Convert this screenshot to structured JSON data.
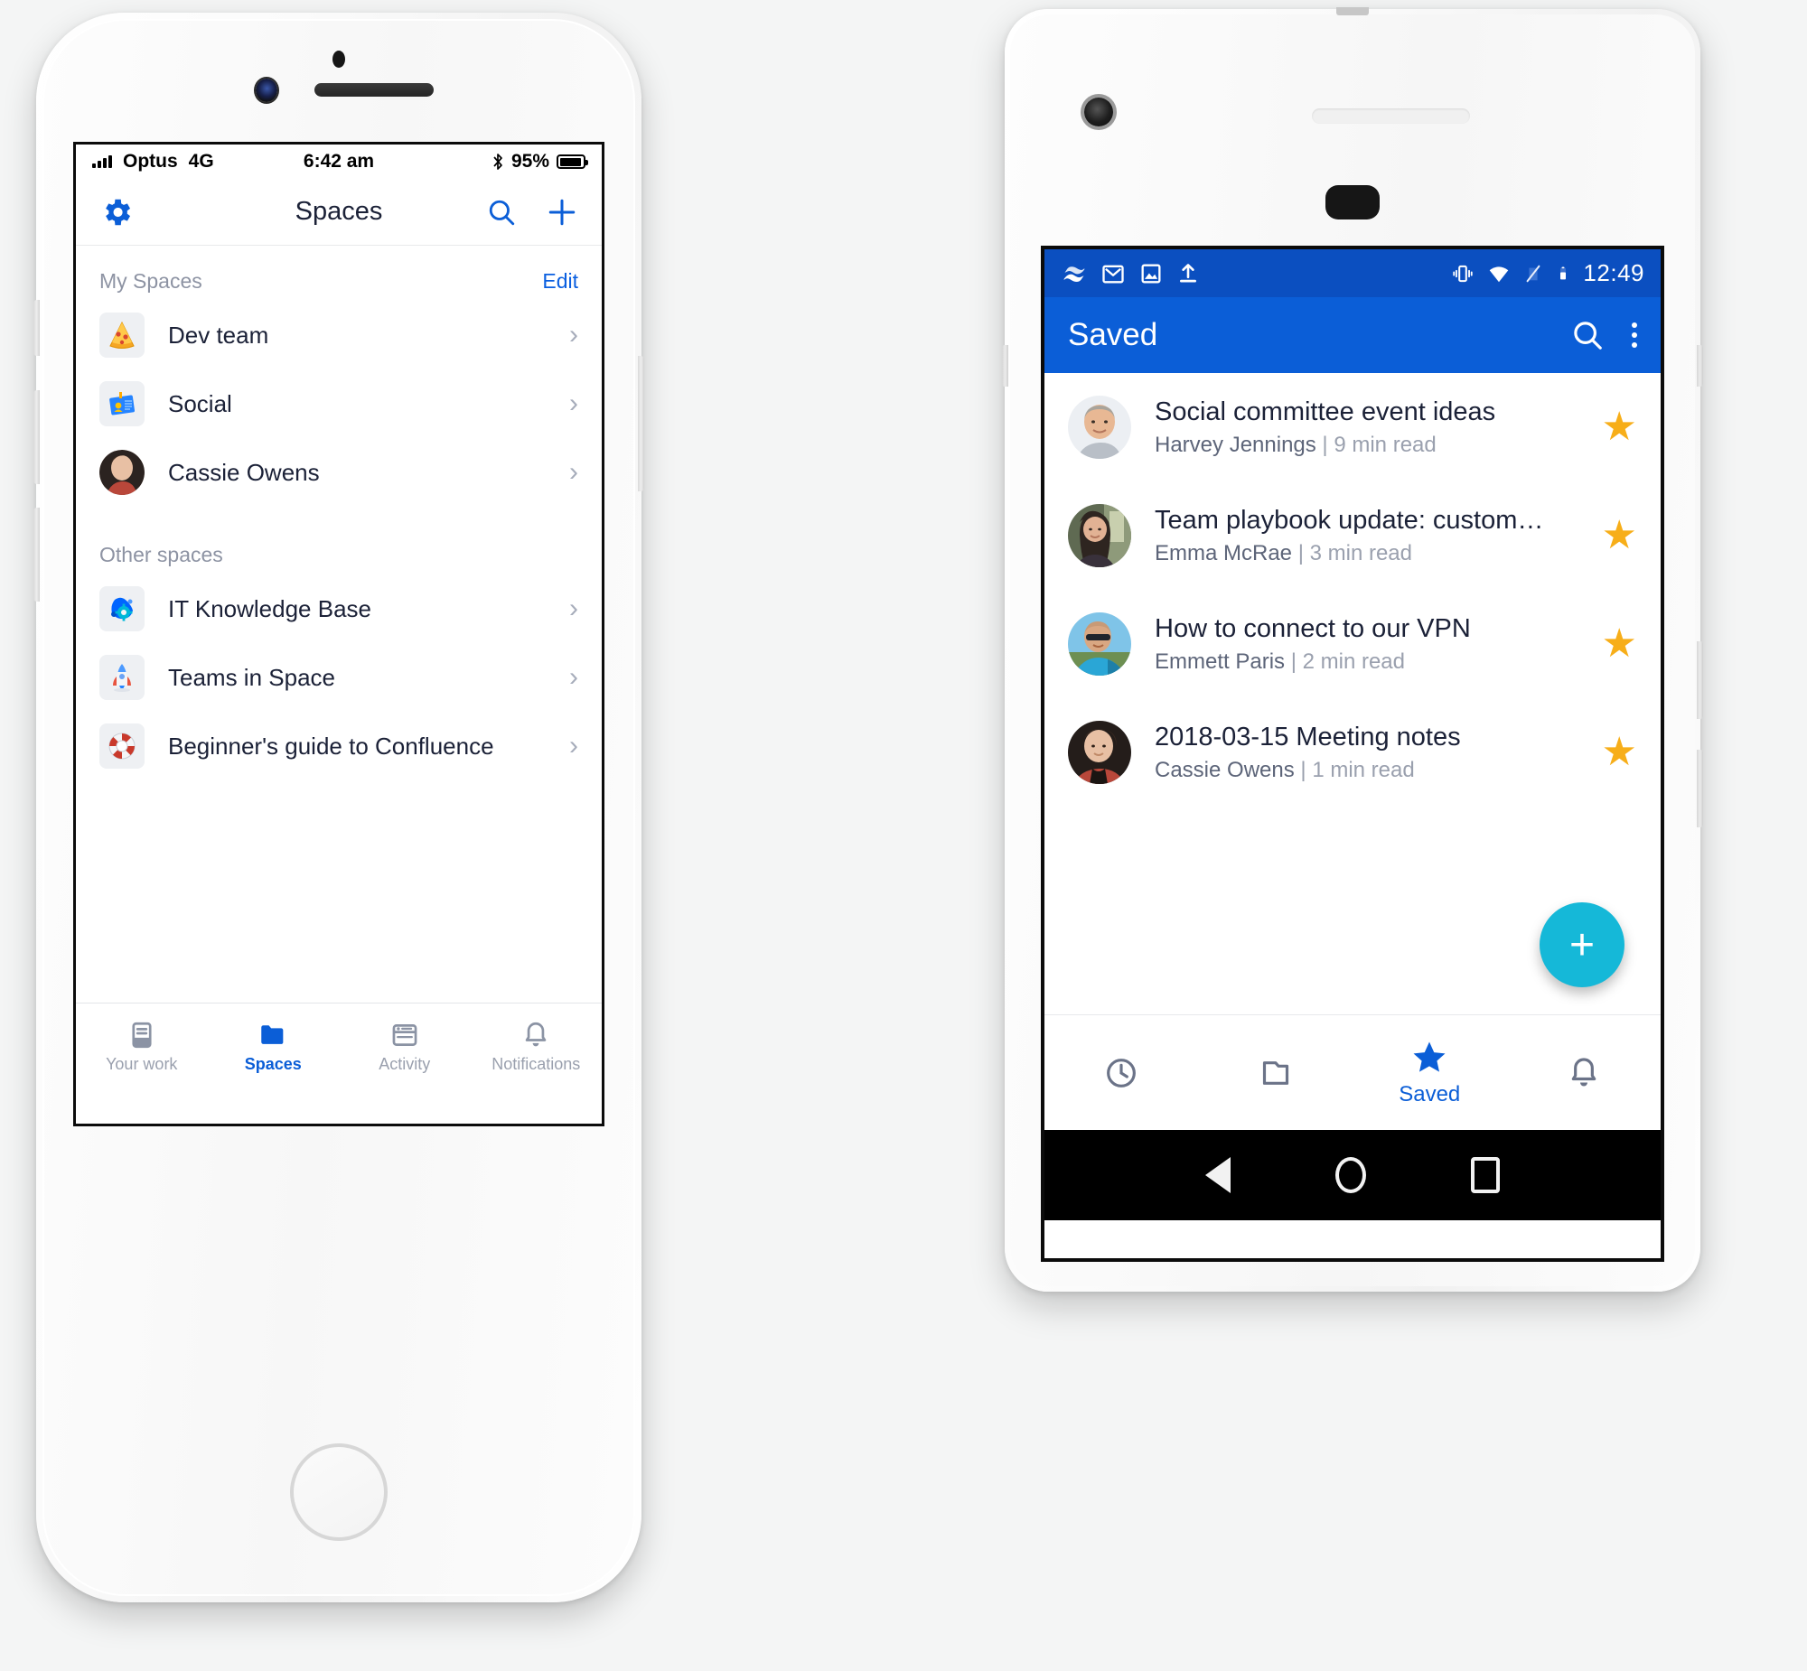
{
  "ios": {
    "status": {
      "carrier": "Optus",
      "network": "4G",
      "time": "6:42 am",
      "battery_percent": "95%",
      "bluetooth_icon": "bluetooth-icon",
      "signal_icon": "signal-bars-icon"
    },
    "nav": {
      "title": "Spaces",
      "settings_icon": "gear-icon",
      "search_icon": "search-icon",
      "add_icon": "plus-icon"
    },
    "sections": [
      {
        "title": "My Spaces",
        "action": "Edit",
        "items": [
          {
            "label": "Dev team",
            "icon": "pizza-icon",
            "glyph": "🍕",
            "type": "emoji"
          },
          {
            "label": "Social",
            "icon": "id-badge-icon",
            "glyph": "🪪",
            "type": "emoji"
          },
          {
            "label": "Cassie Owens",
            "icon": "avatar",
            "glyph": "",
            "type": "avatar"
          }
        ]
      },
      {
        "title": "Other spaces",
        "action": "",
        "items": [
          {
            "label": "IT Knowledge Base",
            "icon": "gear-splash-icon",
            "glyph": "⚙",
            "type": "emoji"
          },
          {
            "label": "Teams in Space",
            "icon": "rocket-icon",
            "glyph": "🚀",
            "type": "emoji"
          },
          {
            "label": "Beginner's guide to Confluence",
            "icon": "life-ring-icon",
            "glyph": "🛟",
            "type": "emoji"
          }
        ]
      }
    ],
    "tabs": [
      {
        "label": "Your work",
        "icon": "your-work-icon",
        "active": false
      },
      {
        "label": "Spaces",
        "icon": "folder-icon",
        "active": true
      },
      {
        "label": "Activity",
        "icon": "activity-icon",
        "active": false
      },
      {
        "label": "Notifications",
        "icon": "bell-icon",
        "active": false
      }
    ],
    "colors": {
      "accent": "#0b5ed7",
      "text": "#1b2137",
      "muted": "#8d93a3"
    }
  },
  "android": {
    "status": {
      "time": "12:49",
      "left_icons": [
        "confluence-icon",
        "gmail-icon",
        "image-icon",
        "upload-icon"
      ],
      "right_icons": [
        "vibrate-icon",
        "wifi-icon",
        "signal-off-icon",
        "battery-icon"
      ]
    },
    "appbar": {
      "title": "Saved",
      "search_icon": "search-icon",
      "overflow_icon": "kebab-menu-icon"
    },
    "items": [
      {
        "title": "Social committee event ideas",
        "author": "Harvey Jennings",
        "read_time": "9 min read",
        "starred": true,
        "avatar": "harvey-avatar"
      },
      {
        "title": "Team playbook update: custom…",
        "author": "Emma McRae",
        "read_time": "3 min read",
        "starred": true,
        "avatar": "emma-avatar"
      },
      {
        "title": "How to connect to our VPN",
        "author": "Emmett Paris",
        "read_time": "2 min read",
        "starred": true,
        "avatar": "emmett-avatar"
      },
      {
        "title": "2018-03-15 Meeting notes",
        "author": "Cassie Owens",
        "read_time": "1 min read",
        "starred": true,
        "avatar": "cassie-avatar"
      }
    ],
    "fab": {
      "icon": "plus-icon",
      "label": "+"
    },
    "tabs": [
      {
        "label": "",
        "icon": "clock-icon",
        "active": false
      },
      {
        "label": "",
        "icon": "folder-icon",
        "active": false
      },
      {
        "label": "Saved",
        "icon": "star-icon",
        "active": true
      },
      {
        "label": "",
        "icon": "bell-icon",
        "active": false
      }
    ],
    "sysnav": [
      {
        "icon": "back-triangle-icon"
      },
      {
        "icon": "home-circle-icon"
      },
      {
        "icon": "recents-square-icon"
      }
    ],
    "colors": {
      "appbar": "#0b5ed7",
      "statusbar": "#0b4fc0",
      "fab": "#15b8d8",
      "star": "#f7ae19",
      "title": "#1b2137"
    }
  }
}
